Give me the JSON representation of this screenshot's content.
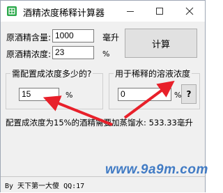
{
  "window": {
    "title": "酒精浓度稀释计算器",
    "min_icon": "minimize-icon",
    "max_icon": "maximize-icon",
    "close_icon": "close-icon",
    "app_icon": "app-icon"
  },
  "form": {
    "orig_amount_label": "原酒精含量:",
    "orig_amount_value": "1000",
    "orig_amount_unit": "毫升",
    "orig_conc_label": "原酒精浓度:",
    "orig_conc_value": "23",
    "orig_conc_unit": "%",
    "calculate_label": "计算"
  },
  "target_group": {
    "legend": "需配置成浓度多少的?",
    "value": "15",
    "unit": "%"
  },
  "dilute_group": {
    "legend": "用于稀释的溶液浓度",
    "value": "0",
    "unit": "%",
    "help_label": "?"
  },
  "result_text": "配置成浓度为15%的酒精需要加蒸馏水: 533.33毫升",
  "status_text": "By 天下第一大傻 QQ:17",
  "watermark_text": "www.9a9m.com",
  "colors": {
    "arrow": "#e8202a",
    "accent": "#2f6fc0"
  }
}
